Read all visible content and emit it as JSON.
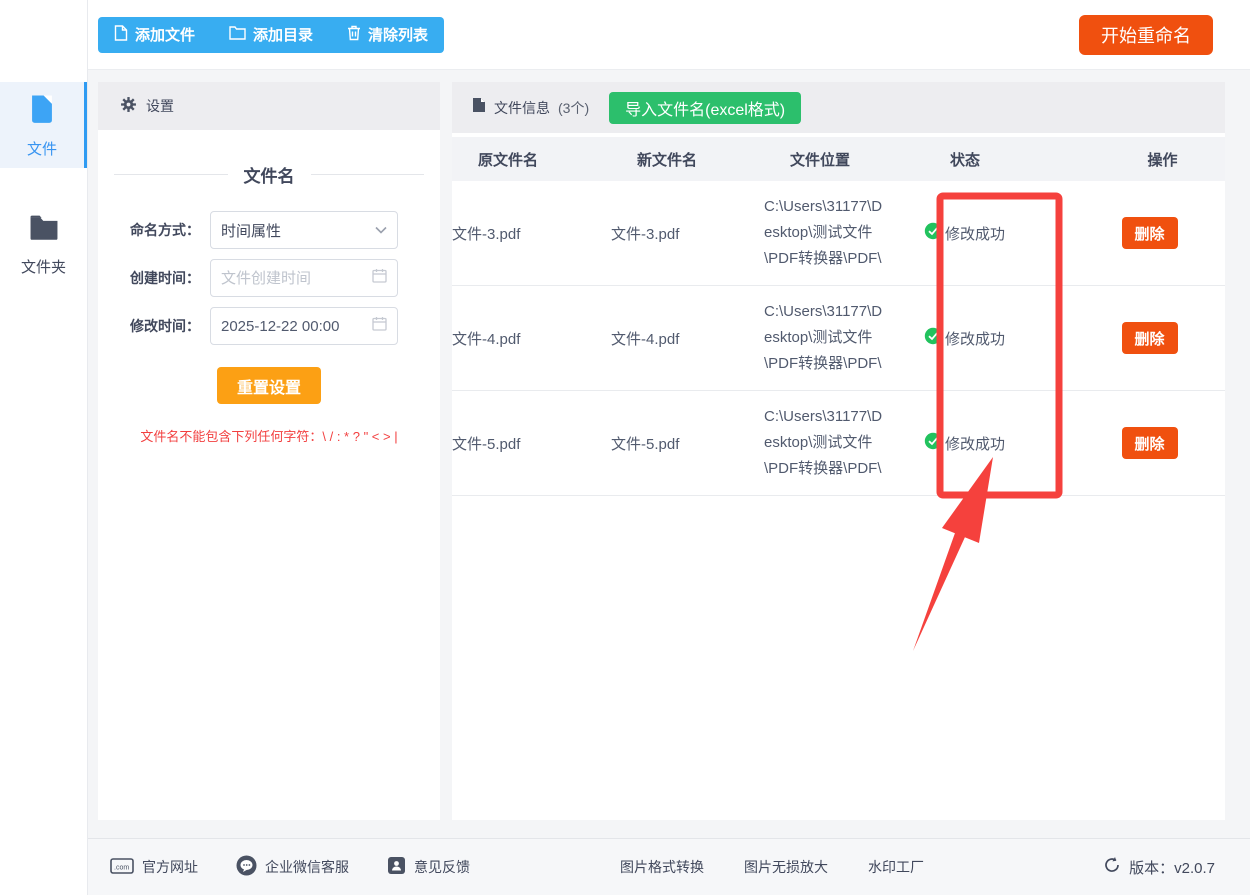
{
  "toolbar": {
    "add_file": "添加文件",
    "add_dir": "添加目录",
    "clear_list": "清除列表",
    "start_rename": "开始重命名"
  },
  "sidebar": {
    "items": [
      {
        "label": "文件"
      },
      {
        "label": "文件夹"
      }
    ]
  },
  "settings": {
    "header": "设置",
    "section_title": "文件名",
    "fields": [
      {
        "label": "命名方式：",
        "value": "时间属性"
      },
      {
        "label": "创建时间：",
        "placeholder": "文件创建时间"
      },
      {
        "label": "修改时间：",
        "value": "2025-12-22 00:00"
      }
    ],
    "reset_label": "重置设置",
    "warning": "文件名不能包含下列任何字符：\\ / : * ? \" < > |"
  },
  "file_table": {
    "header_label": "文件信息",
    "count": "(3个)",
    "import_button": "导入文件名(excel格式)",
    "columns": [
      "原文件名",
      "新文件名",
      "文件位置",
      "状态",
      "操作"
    ],
    "rows": [
      {
        "original": "文件-3.pdf",
        "new_name": "文件-3.pdf",
        "location": "C:\\Users\\31177\\Desktop\\测试文件\\PDF转换器\\PDF\\",
        "status": "修改成功",
        "action": "删除"
      },
      {
        "original": "文件-4.pdf",
        "new_name": "文件-4.pdf",
        "location": "C:\\Users\\31177\\Desktop\\测试文件\\PDF转换器\\PDF\\",
        "status": "修改成功",
        "action": "删除"
      },
      {
        "original": "文件-5.pdf",
        "new_name": "文件-5.pdf",
        "location": "C:\\Users\\31177\\Desktop\\测试文件\\PDF转换器\\PDF\\",
        "status": "修改成功",
        "action": "删除"
      }
    ]
  },
  "footer": {
    "official_site": "官方网址",
    "wechat_service": "企业微信客服",
    "feedback": "意见反馈",
    "img_convert": "图片格式转换",
    "img_upscale": "图片无损放大",
    "watermark": "水印工厂",
    "version": "版本：v2.0.7"
  },
  "colors": {
    "accent_blue": "#38adf1",
    "accent_orange": "#f0500f",
    "accent_amber": "#fca014",
    "accent_green": "#2cbf6c",
    "status_green": "#22c25e",
    "annotation_red": "#f5413d"
  }
}
